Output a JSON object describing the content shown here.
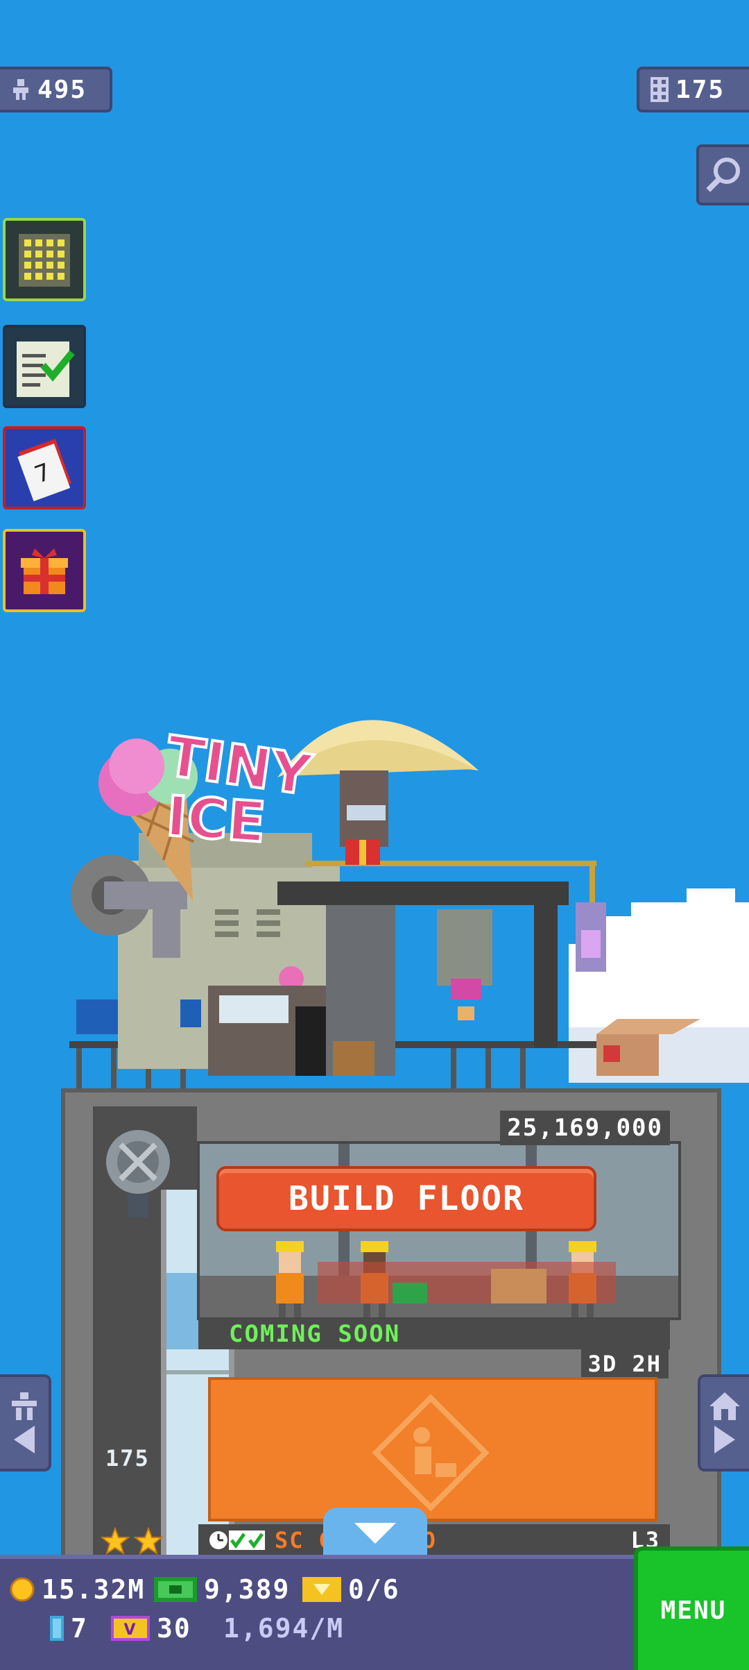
{
  "top": {
    "population": "495",
    "floors": "175"
  },
  "tower": {
    "elevator_level": "175",
    "build_cost": "25,169,000",
    "build_label": "BUILD FLOOR",
    "coming_soon": "COMING SOON",
    "timer": "3D 2H",
    "floor_name": "SC     G STUDIO",
    "floor_level": "L3",
    "roof_sign": "TINY ICE"
  },
  "bottom": {
    "coins": "15.32M",
    "bux": "9,389",
    "tickets": "0/6",
    "keys": "7",
    "vip": "30",
    "rate": "1,694/M",
    "menu_label": "MENU"
  },
  "colors": {
    "sky": "#2196e3",
    "build_button": "#e8552e",
    "menu_button": "#19c42a",
    "coming_soon_text": "#6ff05a"
  }
}
